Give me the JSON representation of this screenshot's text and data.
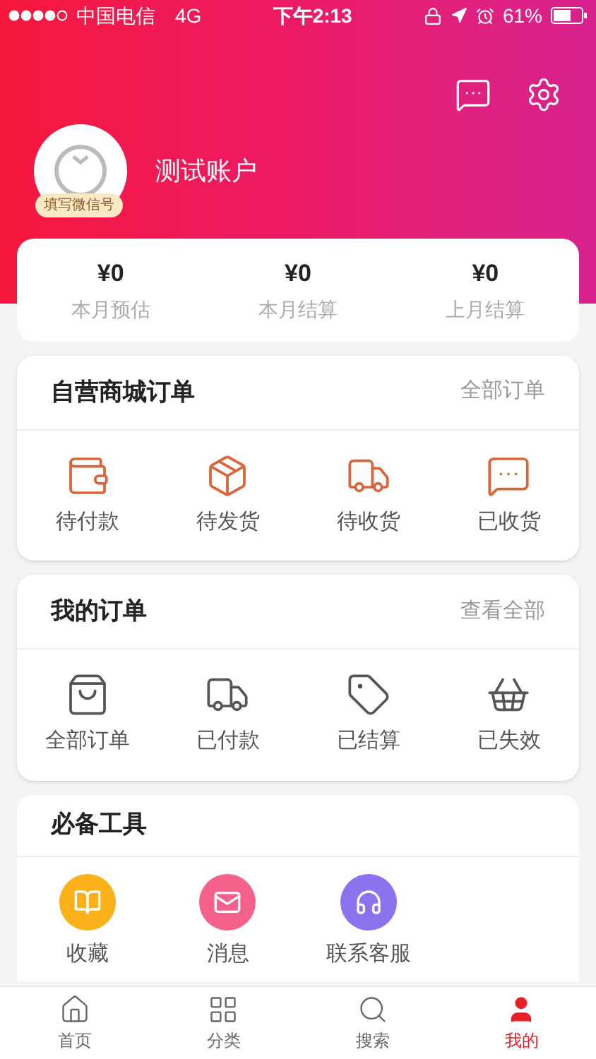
{
  "status_bar": {
    "carrier": "中国电信",
    "network": "4G",
    "time": "下午2:13",
    "battery": "61%"
  },
  "profile": {
    "name": "测试账户",
    "badge": "填写微信号"
  },
  "stats": [
    {
      "value": "¥0",
      "label": "本月预估"
    },
    {
      "value": "¥0",
      "label": "本月结算"
    },
    {
      "value": "¥0",
      "label": "上月结算"
    }
  ],
  "mall_orders": {
    "title": "自营商城订单",
    "link": "全部订单",
    "items": [
      "待付款",
      "待发货",
      "待收货",
      "已收货"
    ]
  },
  "my_orders": {
    "title": "我的订单",
    "link": "查看全部",
    "items": [
      "全部订单",
      "已付款",
      "已结算",
      "已失效"
    ]
  },
  "tools": {
    "title": "必备工具",
    "items": [
      {
        "label": "收藏",
        "color": "#fbb21a"
      },
      {
        "label": "消息",
        "color": "#f4628c"
      },
      {
        "label": "联系客服",
        "color": "#8d72f0"
      }
    ]
  },
  "tab_bar": [
    {
      "label": "首页",
      "selected": false
    },
    {
      "label": "分类",
      "selected": false
    },
    {
      "label": "搜索",
      "selected": false
    },
    {
      "label": "我的",
      "selected": true
    }
  ]
}
